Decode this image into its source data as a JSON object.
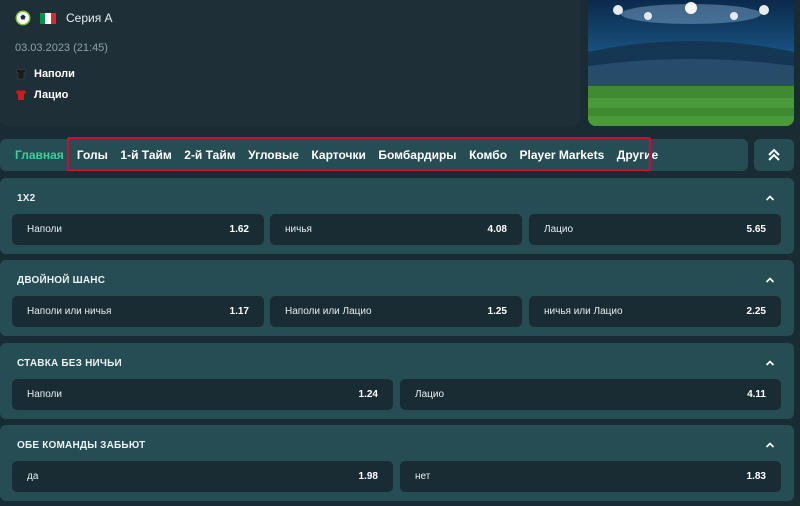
{
  "match": {
    "league": "Серия А",
    "date": "03.03.2023 (21:45)",
    "home_team": "Наполи",
    "away_team": "Лацио",
    "home_shirt_color": "#1b1b1b",
    "away_shirt_color": "#d01b1b",
    "flag_colors": [
      "#009246",
      "#ffffff",
      "#ce2b37"
    ]
  },
  "tabs": [
    "Главная",
    "Голы",
    "1-й Тайм",
    "2-й Тайм",
    "Угловые",
    "Карточки",
    "Бомбардиры",
    "Комбо",
    "Player Markets",
    "Другие"
  ],
  "colors": {
    "accent": "#3ad09a",
    "highlight_box": "#c8102e",
    "panel": "#264c54",
    "button": "#1a2c33"
  },
  "markets": [
    {
      "title": "1X2",
      "outcomes": [
        {
          "label": "Наполи",
          "odds": "1.62"
        },
        {
          "label": "ничья",
          "odds": "4.08"
        },
        {
          "label": "Лацио",
          "odds": "5.65"
        }
      ]
    },
    {
      "title": "ДВОЙНОЙ ШАНС",
      "outcomes": [
        {
          "label": "Наполи или ничья",
          "odds": "1.17"
        },
        {
          "label": "Наполи или Лацио",
          "odds": "1.25"
        },
        {
          "label": "ничья или Лацио",
          "odds": "2.25"
        }
      ]
    },
    {
      "title": "СТАВКА БЕЗ НИЧЬИ",
      "outcomes": [
        {
          "label": "Наполи",
          "odds": "1.24"
        },
        {
          "label": "Лацио",
          "odds": "4.11"
        }
      ]
    },
    {
      "title": "ОБЕ КОМАНДЫ ЗАБЬЮТ",
      "outcomes": [
        {
          "label": "да",
          "odds": "1.98"
        },
        {
          "label": "нет",
          "odds": "1.83"
        }
      ]
    }
  ]
}
